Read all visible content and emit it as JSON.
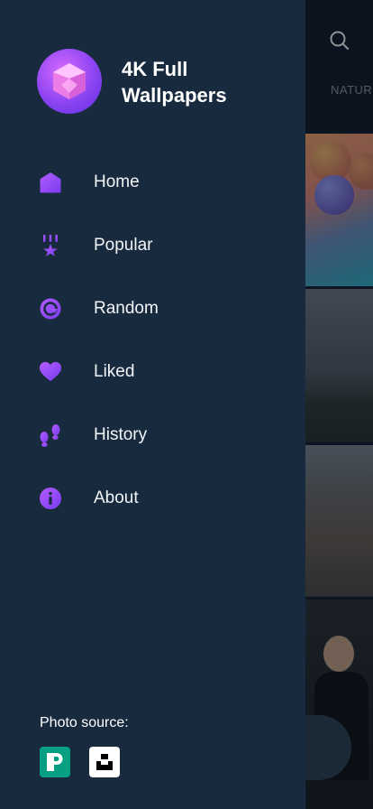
{
  "app": {
    "title": "4K Full Wallpapers",
    "accent": "#8c44f2",
    "drawer_bg": "#182a3d"
  },
  "header": {
    "search_icon": "search-icon",
    "tab_label": "NATURE"
  },
  "menu": {
    "items": [
      {
        "label": "Home",
        "icon": "home-icon"
      },
      {
        "label": "Popular",
        "icon": "popular-icon"
      },
      {
        "label": "Random",
        "icon": "random-icon"
      },
      {
        "label": "Liked",
        "icon": "heart-icon"
      },
      {
        "label": "History",
        "icon": "footprints-icon"
      },
      {
        "label": "About",
        "icon": "info-icon"
      }
    ]
  },
  "footer": {
    "photo_source_label": "Photo source:",
    "sources": [
      {
        "icon": "pexels-icon",
        "color": "#05a081"
      },
      {
        "icon": "unsplash-icon",
        "color": "#ffffff"
      }
    ]
  }
}
